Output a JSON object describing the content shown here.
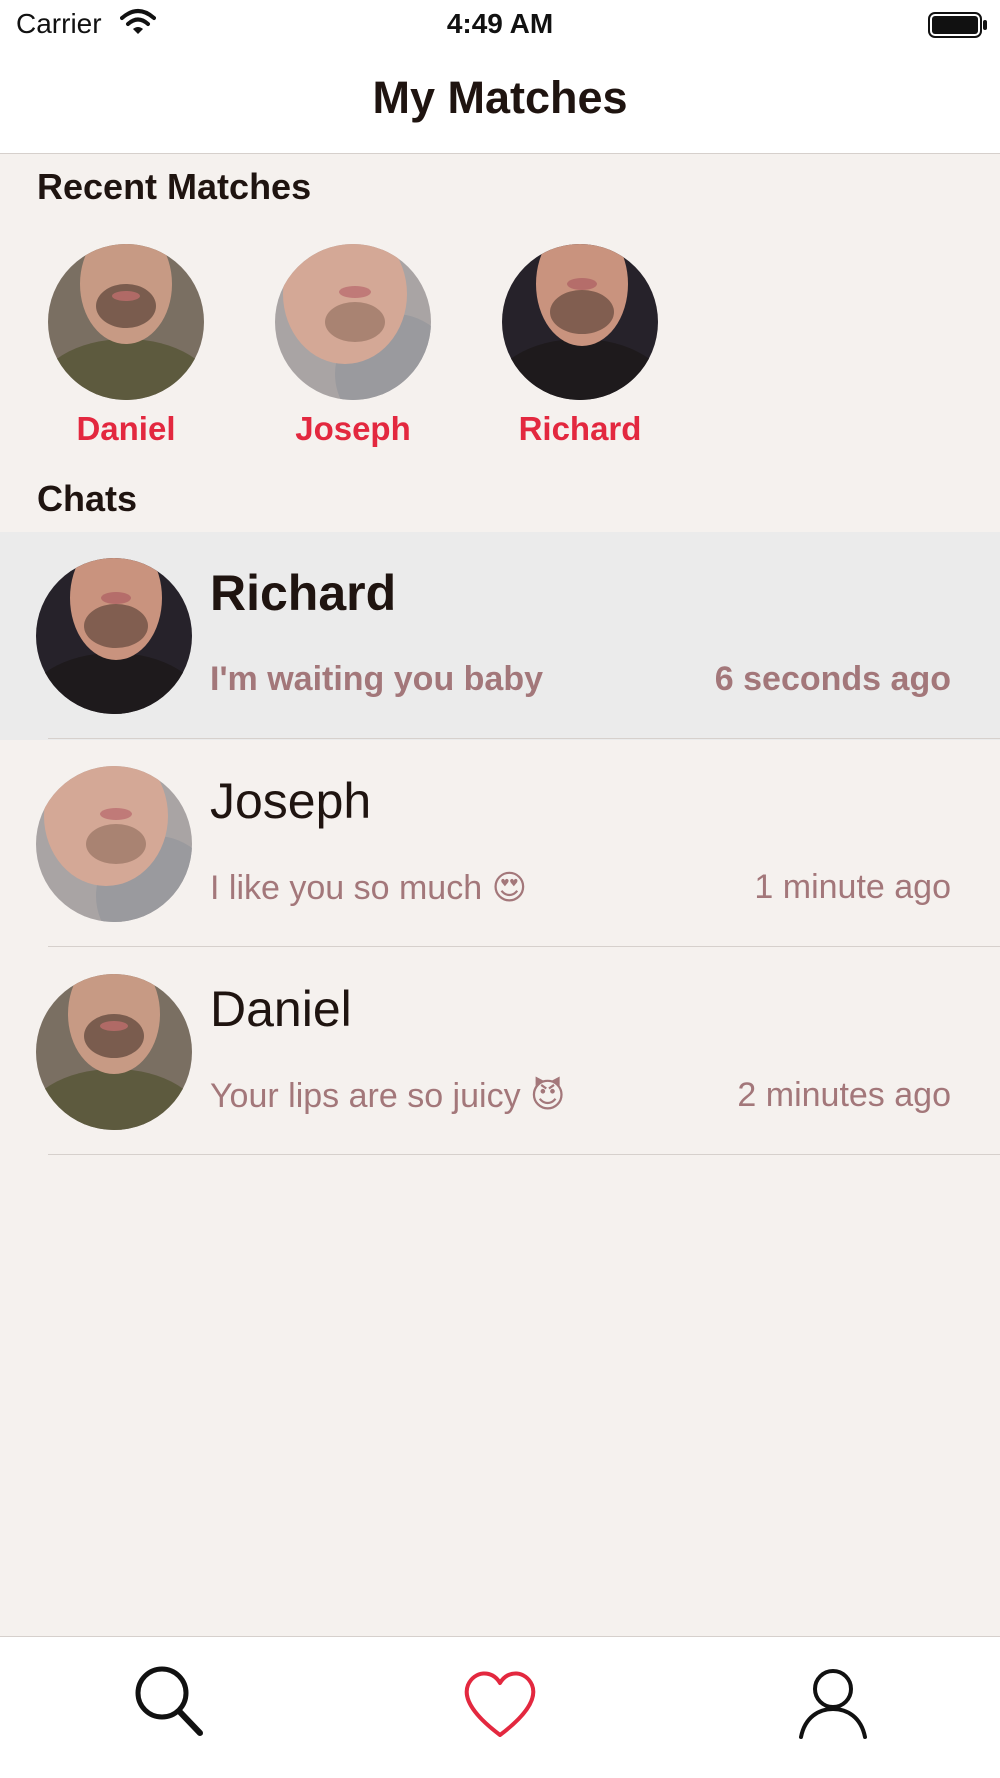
{
  "status_bar": {
    "carrier": "Carrier",
    "time": "4:49 AM"
  },
  "nav": {
    "title": "My Matches"
  },
  "recent_matches": {
    "title": "Recent Matches",
    "items": [
      {
        "name": "Daniel",
        "shirt": "#5d5a3e"
      },
      {
        "name": "Joseph",
        "shirt": "#9a9a9e"
      },
      {
        "name": "Richard",
        "shirt": "#1e1a1c"
      }
    ]
  },
  "chats": {
    "title": "Chats",
    "items": [
      {
        "name": "Richard",
        "message": "I'm waiting you baby",
        "emoji": "",
        "time": "6 seconds ago",
        "selected": true,
        "shirt": "#1e1a1c"
      },
      {
        "name": "Joseph",
        "message": "I like you so much",
        "emoji": "😍",
        "time": "1 minute ago",
        "selected": false,
        "shirt": "#9a9a9e"
      },
      {
        "name": "Daniel",
        "message": "Your lips are so juicy",
        "emoji": "😈",
        "time": "2 minutes ago",
        "selected": false,
        "shirt": "#5d5a3e"
      }
    ]
  },
  "tab_bar": {
    "items": [
      {
        "icon": "search-icon"
      },
      {
        "icon": "heart-icon",
        "active": true
      },
      {
        "icon": "profile-icon"
      }
    ]
  },
  "colors": {
    "accent": "#e3283f",
    "message": "#a3777a",
    "background": "#f5f1ee"
  }
}
